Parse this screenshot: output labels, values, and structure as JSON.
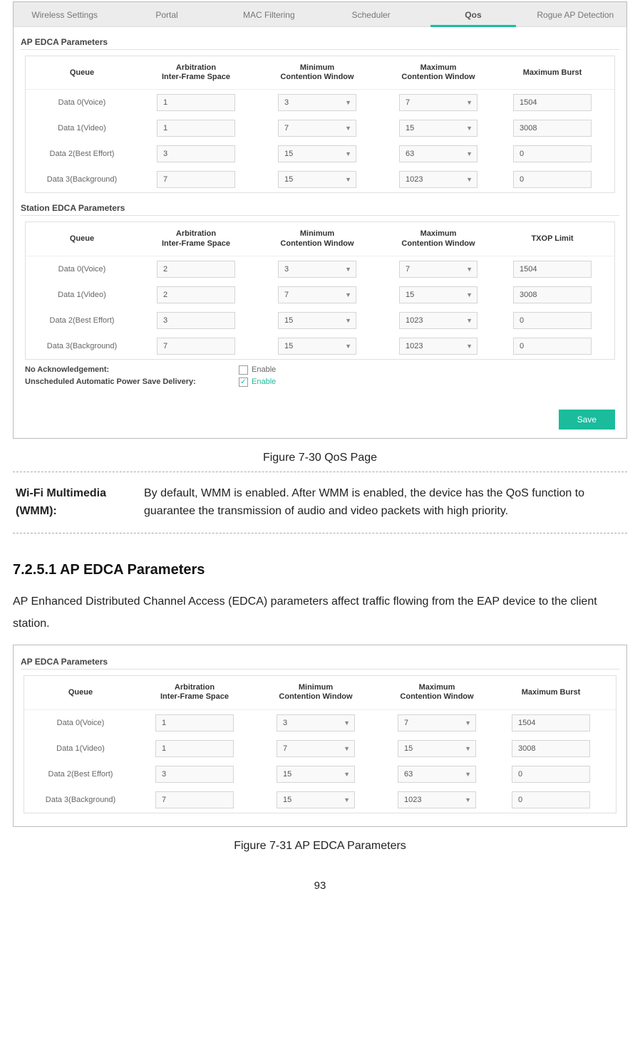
{
  "tabs": [
    "Wireless Settings",
    "Portal",
    "MAC Filtering",
    "Scheduler",
    "Qos",
    "Rogue AP Detection"
  ],
  "active_tab_index": 4,
  "ap_panel": {
    "title": "AP EDCA Parameters",
    "headers": [
      "Queue",
      "Arbitration\nInter-Frame Space",
      "Minimum\nContention Window",
      "Maximum\nContention Window",
      "Maximum Burst"
    ],
    "rows": [
      {
        "q": "Data 0(Voice)",
        "aifs": "1",
        "min": "3",
        "max": "7",
        "last": "1504"
      },
      {
        "q": "Data 1(Video)",
        "aifs": "1",
        "min": "7",
        "max": "15",
        "last": "3008"
      },
      {
        "q": "Data 2(Best Effort)",
        "aifs": "3",
        "min": "15",
        "max": "63",
        "last": "0"
      },
      {
        "q": "Data 3(Background)",
        "aifs": "7",
        "min": "15",
        "max": "1023",
        "last": "0"
      }
    ]
  },
  "sta_panel": {
    "title": "Station EDCA Parameters",
    "headers": [
      "Queue",
      "Arbitration\nInter-Frame Space",
      "Minimum\nContention Window",
      "Maximum\nContention Window",
      "TXOP Limit"
    ],
    "rows": [
      {
        "q": "Data 0(Voice)",
        "aifs": "2",
        "min": "3",
        "max": "7",
        "last": "1504"
      },
      {
        "q": "Data 1(Video)",
        "aifs": "2",
        "min": "7",
        "max": "15",
        "last": "3008"
      },
      {
        "q": "Data 2(Best Effort)",
        "aifs": "3",
        "min": "15",
        "max": "1023",
        "last": "0"
      },
      {
        "q": "Data 3(Background)",
        "aifs": "7",
        "min": "15",
        "max": "1023",
        "last": "0"
      }
    ]
  },
  "no_ack": {
    "label": "No Acknowledgement:",
    "enable": "Enable",
    "checked": false
  },
  "uapsd": {
    "label": "Unscheduled Automatic Power Save Delivery:",
    "enable": "Enable",
    "checked": true
  },
  "save_label": "Save",
  "fig1": "Figure 7-30 QoS Page",
  "def_term": "Wi-Fi Multimedia (WMM):",
  "def_body": "By default, WMM is enabled. After WMM is enabled, the device has the QoS function to guarantee the transmission of audio and video packets with high priority.",
  "sec_head": "7.2.5.1  AP EDCA Parameters",
  "para1": "AP Enhanced Distributed Channel Access (EDCA) parameters affect traffic flowing from the EAP device to the client station.",
  "fig2": "Figure 7-31 AP EDCA Parameters",
  "page_number": "93"
}
